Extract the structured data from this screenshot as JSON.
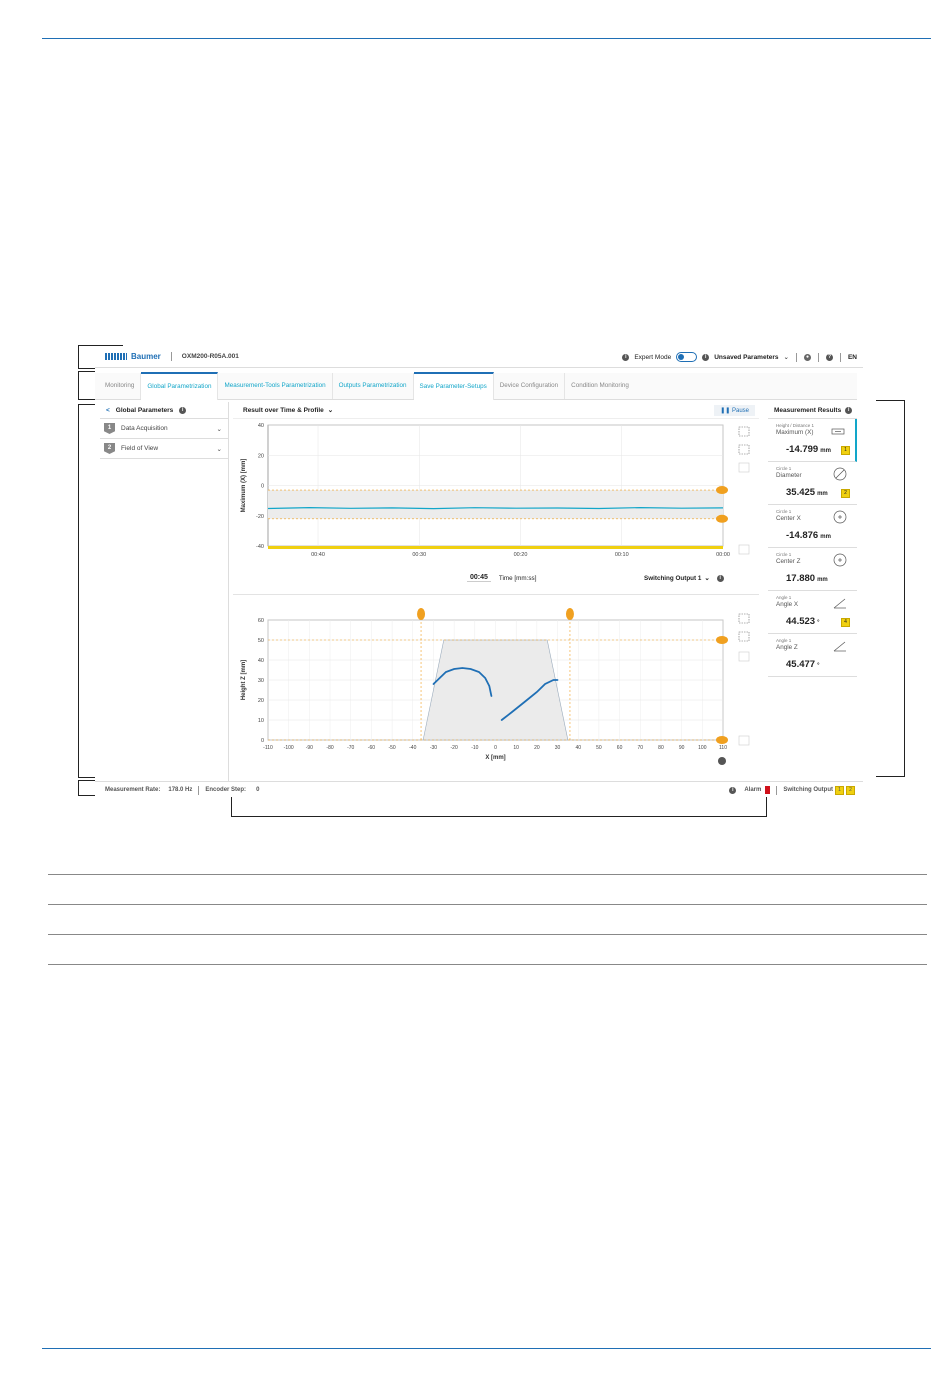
{
  "topbar": {
    "brand": "Baumer",
    "device": "OXM200-R05A.001",
    "expert_mode": "Expert Mode",
    "toggle_state": "OFF",
    "unsaved": "Unsaved Parameters",
    "language": "EN"
  },
  "tabs": [
    {
      "label": "Monitoring",
      "style": "grey"
    },
    {
      "label": "Global Parametrization",
      "style": "cyan-active"
    },
    {
      "label": "Measurement-Tools Parametrization",
      "style": "cyan"
    },
    {
      "label": "Outputs Parametrization",
      "style": "cyan"
    },
    {
      "label": "Save Parameter-Setups",
      "style": "cyan-active"
    },
    {
      "label": "Device Configuration",
      "style": "grey"
    },
    {
      "label": "Condition Monitoring",
      "style": "grey"
    }
  ],
  "left_panel": {
    "back": "<",
    "title": "Global Parameters",
    "items": [
      {
        "num": "1",
        "label": "Data Acquisition"
      },
      {
        "num": "2",
        "label": "Field of View"
      }
    ]
  },
  "center": {
    "view_select": "Result over Time & Profile",
    "pause": "Pause",
    "time_value": "00:45",
    "time_label": "Time [mm:ss]",
    "switching_output": "Switching Output 1"
  },
  "chart_data": [
    {
      "type": "line",
      "ylabel": "Maximum (X) [mm]",
      "xlabel": "Time [mm:ss]",
      "ylim": [
        -40,
        40
      ],
      "yticks": [
        "40",
        "20",
        "0",
        "-20",
        "-40"
      ],
      "xticks": [
        "00:40",
        "00:30",
        "00:20",
        "00:10",
        "00:00"
      ],
      "series": [
        {
          "values": [
            -15.2,
            -14.6,
            -15.1,
            -14.8,
            -15.3,
            -14.7,
            -15.0,
            -14.9,
            -15.2,
            -14.6,
            -15.0,
            -14.8
          ]
        }
      ],
      "band": [
        -3,
        -22
      ]
    },
    {
      "type": "line",
      "ylabel": "Height Z [mm]",
      "xlabel": "X [mm]",
      "xlim": [
        -110,
        110
      ],
      "ylim": [
        0,
        60
      ],
      "yticks": [
        "60",
        "50",
        "40",
        "30",
        "20",
        "10",
        "0"
      ],
      "xticks": [
        "-110",
        "-100",
        "-90",
        "-80",
        "-70",
        "-60",
        "-50",
        "-40",
        "-30",
        "-20",
        "-10",
        "0",
        "10",
        "20",
        "30",
        "40",
        "50",
        "60",
        "70",
        "80",
        "90",
        "100",
        "110"
      ],
      "series": [
        {
          "x": [
            -30,
            -27,
            -24,
            -20,
            -16,
            -12,
            -8,
            -5,
            -3,
            -2
          ],
          "y": [
            28,
            31,
            34,
            35.5,
            36,
            35.5,
            34,
            31,
            27,
            22
          ]
        },
        {
          "x": [
            3,
            8,
            14,
            20,
            24,
            28,
            30
          ],
          "y": [
            10,
            14,
            19,
            24,
            28,
            30,
            30
          ]
        }
      ]
    }
  ],
  "measurement_results": {
    "title": "Measurement Results",
    "cards": [
      {
        "category": "Height / Distance 1",
        "name": "Maximum (X)",
        "value": "-14.799",
        "unit": "mm",
        "badge": "1",
        "icon": "height-icon"
      },
      {
        "category": "Circle 1",
        "name": "Diameter",
        "value": "35.425",
        "unit": "mm",
        "badge": "2",
        "icon": "diameter-icon"
      },
      {
        "category": "Circle 1",
        "name": "Center X",
        "value": "-14.876",
        "unit": "mm",
        "badge": "",
        "icon": "center-icon"
      },
      {
        "category": "Circle 1",
        "name": "Center Z",
        "value": "17.880",
        "unit": "mm",
        "badge": "",
        "icon": "center-icon"
      },
      {
        "category": "Angle 1",
        "name": "Angle X",
        "value": "44.523",
        "unit": "°",
        "badge": "4",
        "icon": "angle-icon"
      },
      {
        "category": "Angle 1",
        "name": "Angle Z",
        "value": "45.477",
        "unit": "°",
        "badge": "",
        "icon": "angle-icon"
      }
    ]
  },
  "statusbar": {
    "rate_label": "Measurement Rate:",
    "rate_value": "178.0 Hz",
    "encoder_label": "Encoder Step:",
    "encoder_value": "0",
    "alarm": "Alarm",
    "switching_output": "Switching Output",
    "so1": "1",
    "so2": "2"
  },
  "colors": {
    "brand": "#1f6fb5",
    "accent": "#12a6c9",
    "marker": "#f0a020",
    "badge": "#f0d010",
    "alarm": "#d0111b"
  }
}
